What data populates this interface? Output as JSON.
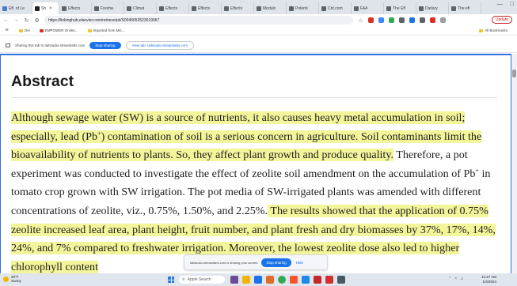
{
  "browser": {
    "tabs": [
      {
        "label": "Eff. of Le",
        "color": "#4a7bd0"
      },
      {
        "label": "Sh",
        "color": "#202124",
        "active": true
      },
      {
        "label": "Effects",
        "color": "#5f6368"
      },
      {
        "label": "Freshw",
        "color": "#5f6368"
      },
      {
        "label": "Climat",
        "color": "#5f6368"
      },
      {
        "label": "Effects",
        "color": "#5f6368"
      },
      {
        "label": "Effects",
        "color": "#5f6368"
      },
      {
        "label": "Effects",
        "color": "#5f6368"
      },
      {
        "label": "Modulo",
        "color": "#5f6368"
      },
      {
        "label": "Potenti",
        "color": "#5f6368"
      },
      {
        "label": "Crit.com",
        "color": "#5f6368"
      },
      {
        "label": "FAA",
        "color": "#5f6368"
      },
      {
        "label": "The Eff",
        "color": "#5f6368"
      },
      {
        "label": "Dietary",
        "color": "#5f6368"
      },
      {
        "label": "The eff",
        "color": "#5f6368"
      }
    ],
    "url": "https://linkinghub.elsevier.com/retrieve/pii/S0045653523019967",
    "update_label": "Update"
  },
  "bookmarks": {
    "items": [
      {
        "label": "Del",
        "style": "yellow"
      },
      {
        "label": "EMPOWER Online...",
        "style": "red"
      },
      {
        "label": "Imported from Mic...",
        "style": "yellow"
      }
    ],
    "all_label": "All Bookmarks"
  },
  "sharebar": {
    "message": "Sharing this tab to tailstudio.streamlabs.com",
    "stop_label": "Stop sharing",
    "view_label": "View tab: tailstudio.streamlabs.com"
  },
  "article": {
    "heading": "Abstract",
    "hl1_a": "Although sewage water (SW) is a source of nutrients, it also causes heavy metal accumulation in soil; especially, lead (Pb",
    "sup1": "+",
    "hl1_b": ") contamination of soil is a serious concern in agriculture. Soil contaminants limit the bioavailability of nutrients to plants. So, they affect plant growth and produce quality.",
    "plain1": " Therefore, a pot experiment was conducted to investigate the effect of zeolite soil amendment on the accumulation of Pb",
    "sup2": "+",
    "plain2": " in tomato crop grown with SW irrigation. The pot media of SW-irrigated plants was amended with different concentrations of zeolite, viz., 0.75%, 1.50%, and 2.25%.",
    "hl2": " The results showed that the application of 0.75% zeolite increased leaf area, plant height, fruit number, and plant fresh and dry biomasses by 37%, 17%, 14%, 24%, and 7% compared to freshwater irrigation. Moreover, the lowest zeolite dose also led to higher chlorophyll content"
  },
  "share_pill": {
    "message": "tailstudio.streamlabs.com is sharing your screen.",
    "stop_label": "Stop sharing",
    "hide_label": "Hide"
  },
  "taskbar": {
    "weather_temp": "30°F",
    "weather_desc": "Sunny",
    "search_placeholder": "Apple Search",
    "time": "11:27 AM",
    "date": "1/4/2024"
  }
}
